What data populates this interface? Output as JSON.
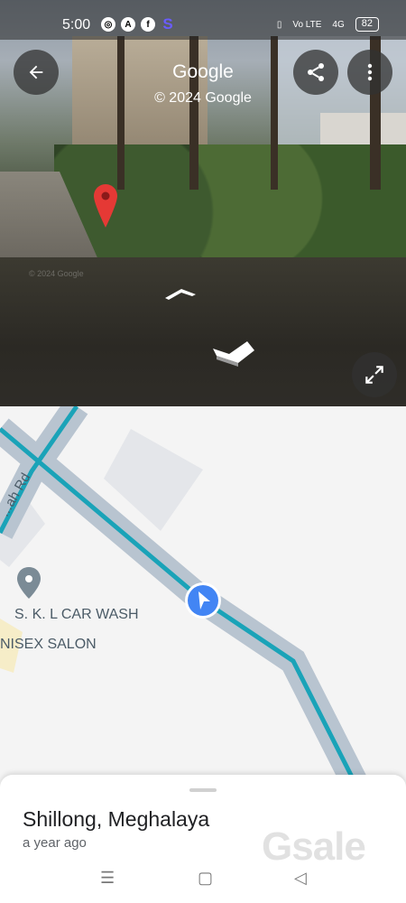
{
  "status_bar": {
    "time": "5:00",
    "left_icons": [
      "instagram-icon",
      "app-a-icon",
      "facebook-icon",
      "s-app-icon"
    ],
    "right_icons": [
      "vibrate-icon",
      "volte-icon",
      "signal-4g-icon"
    ],
    "volte_label": "Vo LTE",
    "network_label": "4G",
    "battery": "82"
  },
  "street_view": {
    "title": "Google",
    "copyright": "© 2024 Google",
    "watermark": "© 2024 Google",
    "buttons": [
      "back-arrow-icon",
      "share-icon",
      "more-vert-icon",
      "expand-icon"
    ],
    "pin_color": "#e53935"
  },
  "map": {
    "road_label": "...ah Rd",
    "pois": [
      {
        "label": "S. K. L CAR WASH"
      },
      {
        "label": "NISEX SALON"
      }
    ],
    "route_color": "#1aa3b8",
    "road_color": "#b8c4d0",
    "location_marker_color": "#4285f4"
  },
  "place": {
    "title": "Shillong, Meghalaya",
    "time": "a year ago",
    "watermark": "Gsale"
  },
  "nav": {
    "icons": [
      "menu-icon",
      "home-square-icon",
      "back-triangle-icon"
    ]
  }
}
